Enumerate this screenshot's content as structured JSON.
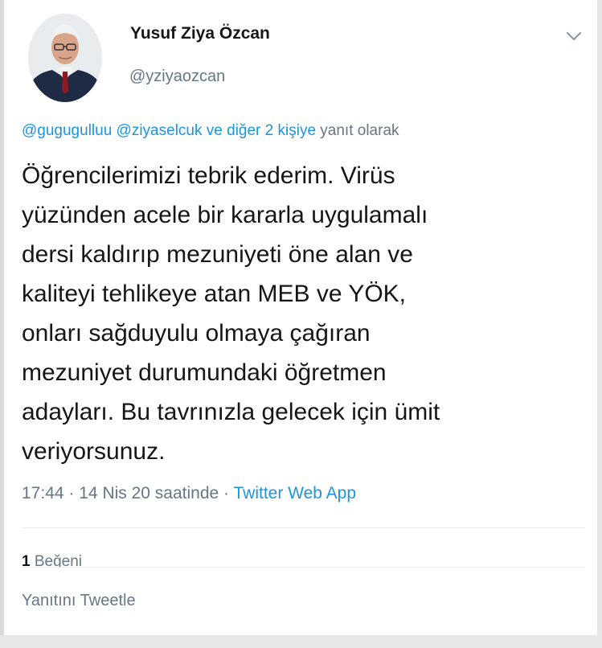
{
  "author": {
    "display_name": "Yusuf Ziya Özcan",
    "handle": "@yziyaozcan"
  },
  "icons": {
    "menu": "chevron-down-icon",
    "avatar": "profile-photo"
  },
  "reply_to": {
    "mention_1": "@gugugulluu",
    "mention_2": "@ziyaselcuk",
    "connector": "ve",
    "others": "diğer 2 kişiye",
    "suffix": "yanıt olarak"
  },
  "tweet": {
    "lines": [
      "Öğrencilerimizi tebrik ederim. Virüs",
      "yüzünden acele bir kararla uygulamalı",
      "dersi kaldırıp mezuniyeti öne alan ve",
      "kaliteyi tehlikeye atan MEB ve YÖK,",
      "onları sağduyulu olmaya çağıran",
      "mezuniyet durumundaki öğretmen",
      "adayları. Bu tavrınızla gelecek için ümit",
      "veriyorsunuz."
    ]
  },
  "meta": {
    "time": "17:44",
    "date": "14 Nis 20 saatinde",
    "separator": "·",
    "source": "Twitter Web App"
  },
  "stats": {
    "likes_count": "1",
    "likes_label": "Beğeni"
  },
  "reply_box": {
    "placeholder": "Yanıtını Tweetle"
  },
  "colors": {
    "link": "#1b95e0",
    "secondary_text": "#657786",
    "primary_text": "#14171a",
    "divider": "#e6ecf0"
  }
}
